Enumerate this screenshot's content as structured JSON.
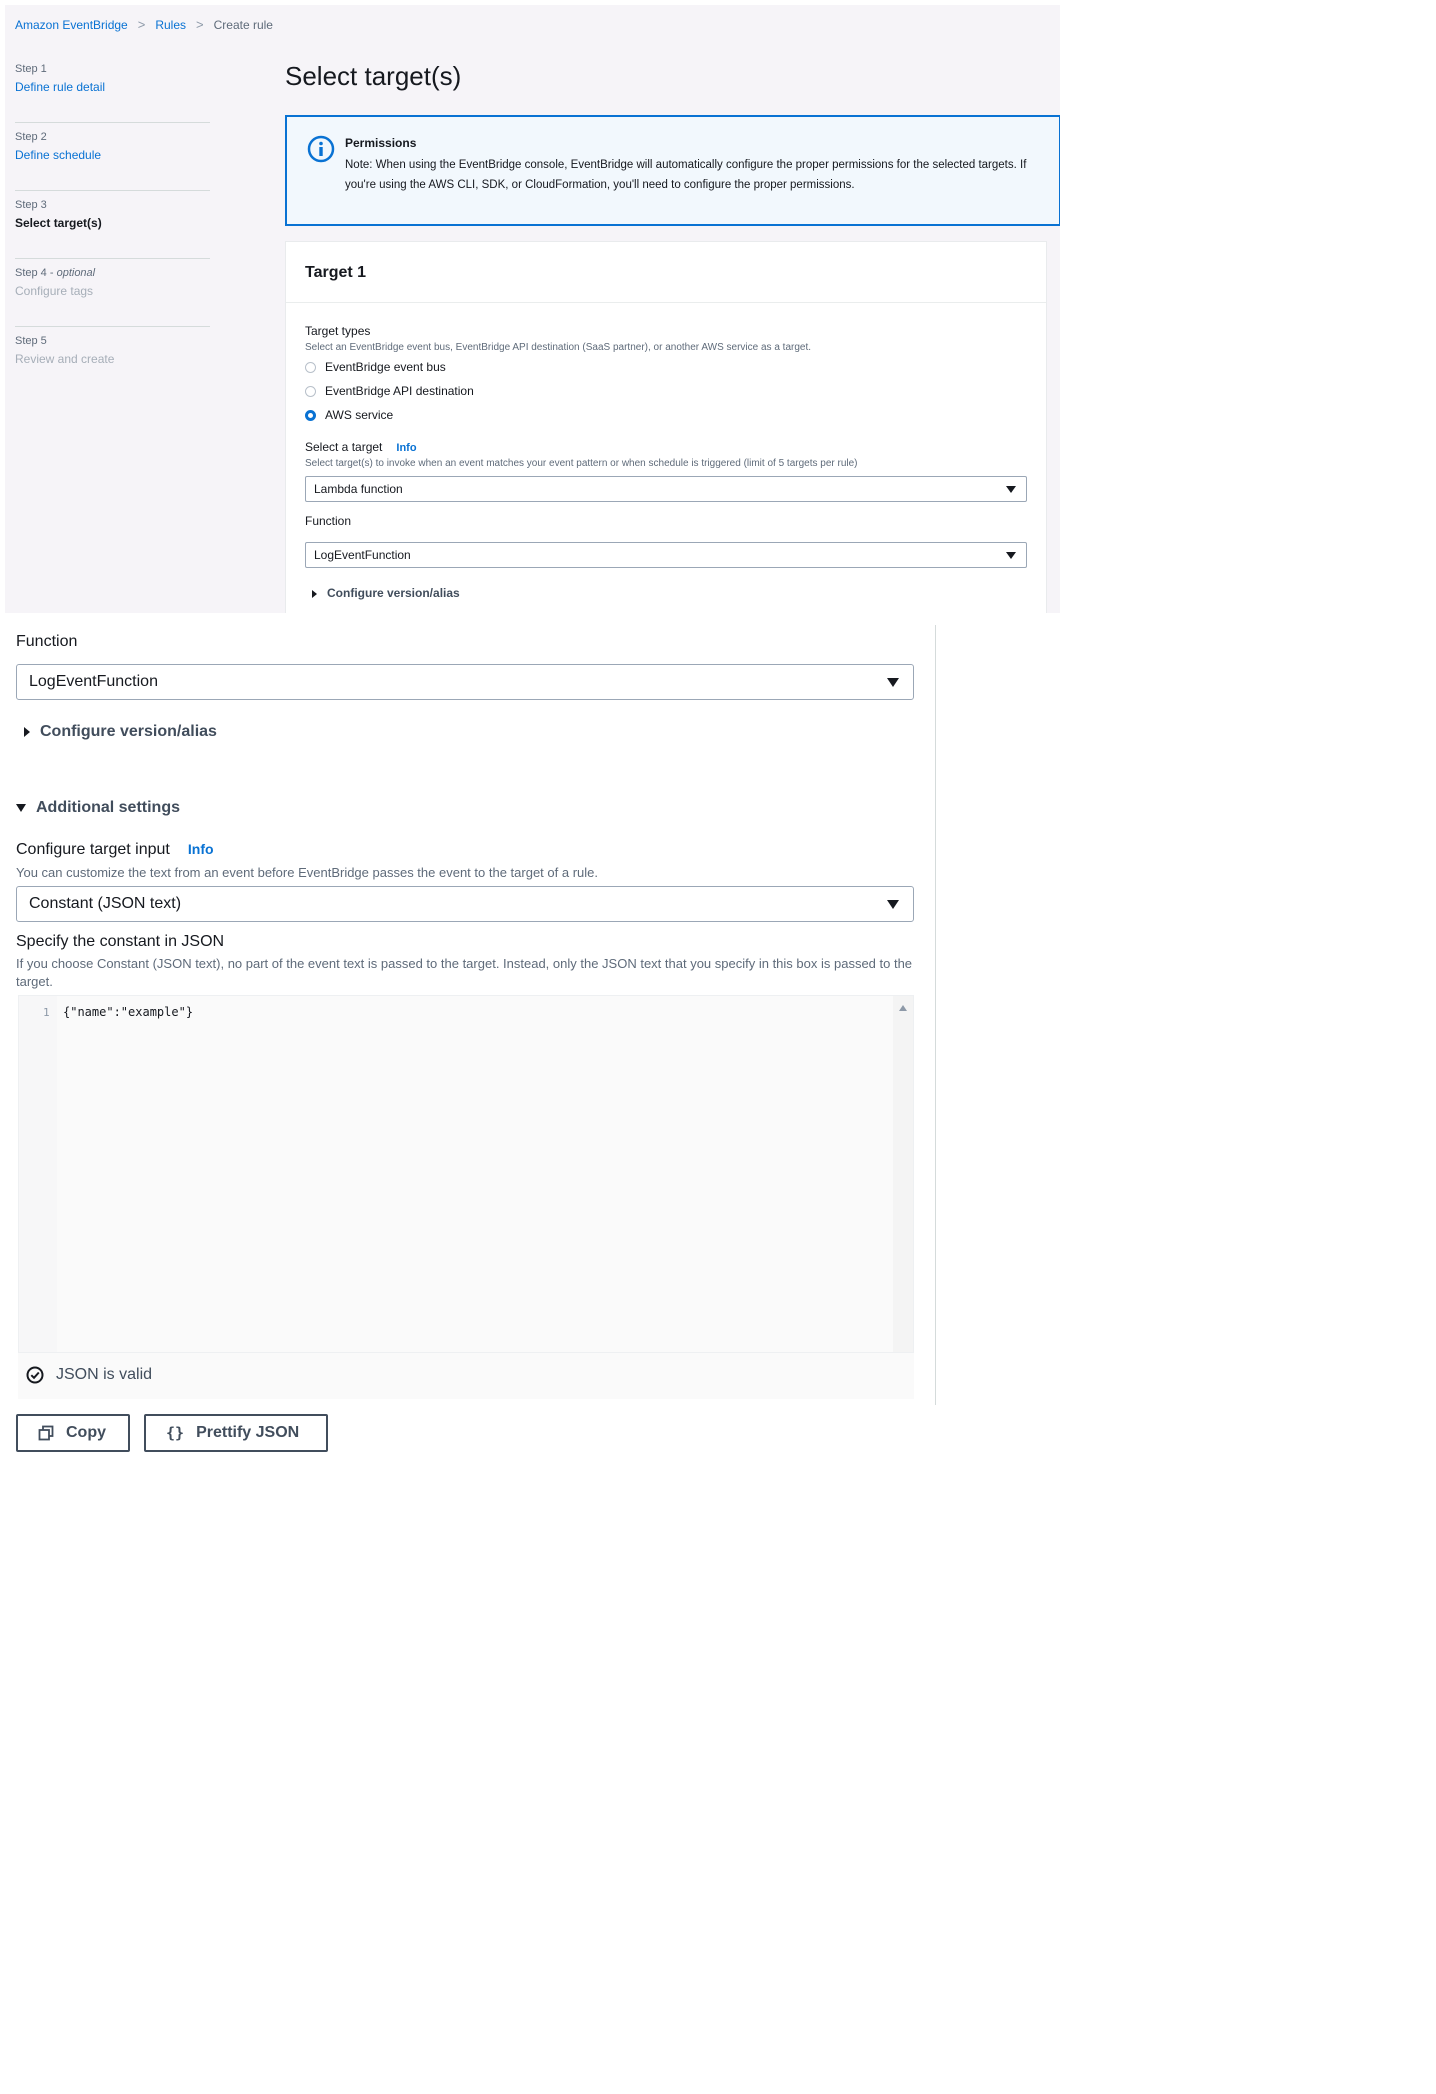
{
  "breadcrumb": {
    "items": [
      "Amazon EventBridge",
      "Rules",
      "Create rule"
    ]
  },
  "steps": [
    {
      "num": "Step 1",
      "optional": "",
      "title": "Define rule detail",
      "state": "link"
    },
    {
      "num": "Step 2",
      "optional": "",
      "title": "Define schedule",
      "state": "link"
    },
    {
      "num": "Step 3",
      "optional": "",
      "title": "Select target(s)",
      "state": "current"
    },
    {
      "num": "Step 4 - ",
      "optional": "optional",
      "title": "Configure tags",
      "state": "disabled"
    },
    {
      "num": "Step 5",
      "optional": "",
      "title": "Review and create",
      "state": "disabled"
    }
  ],
  "page_title": "Select target(s)",
  "alert": {
    "title": "Permissions",
    "text": "Note: When using the EventBridge console, EventBridge will automatically configure the proper permissions for the selected targets. If you're using the AWS CLI, SDK, or CloudFormation, you'll need to configure the proper permissions."
  },
  "target": {
    "title": "Target 1",
    "types_label": "Target types",
    "types_desc": "Select an EventBridge event bus, EventBridge API destination (SaaS partner), or another AWS service as a target.",
    "options": [
      "EventBridge event bus",
      "EventBridge API destination",
      "AWS service"
    ],
    "selected_option": "AWS service",
    "select_label": "Select a target",
    "info": "Info",
    "select_desc": "Select target(s) to invoke when an event matches your event pattern or when schedule is triggered (limit of 5 targets per rule)",
    "select_value": "Lambda function",
    "function_label": "Function",
    "function_value": "LogEventFunction",
    "configure_alias": "Configure version/alias"
  },
  "zoom": {
    "function_label": "Function",
    "function_value": "LogEventFunction",
    "configure_alias": "Configure version/alias",
    "additional_settings": "Additional settings",
    "input_label": "Configure target input",
    "info": "Info",
    "input_desc": "You can customize the text from an event before EventBridge passes the event to the target of a rule.",
    "input_value": "Constant (JSON text)",
    "json_label": "Specify the constant in JSON",
    "json_desc": "If you choose Constant (JSON text), no part of the event text is passed to the target. Instead, only the JSON text that you specify in this box is passed to the target.",
    "line_number": "1",
    "json_code": "{\"name\":\"example\"}",
    "status": "JSON is valid",
    "copy_button": "Copy",
    "prettify_button": "Prettify JSON"
  },
  "colors": {
    "accent": "#0972d3",
    "text": "#16191f",
    "muted": "#5f6b7a"
  }
}
